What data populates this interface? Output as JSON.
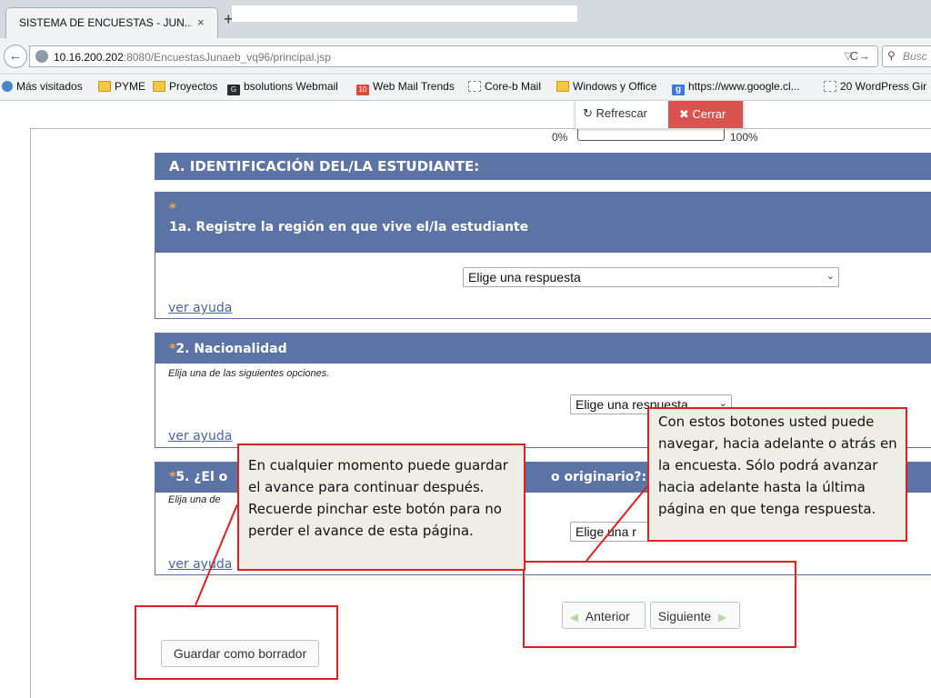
{
  "browser": {
    "tab_title": "SISTEMA DE ENCUESTAS - JUN...",
    "tab_close": "×",
    "new_tab": "+",
    "url_host": "10.16.200.202",
    "url_path": ":8080/EncuestasJunaeb_vq96/principal.jsp",
    "search_placeholder": "Busc",
    "bookmarks": [
      {
        "label": "Más visitados",
        "icon": "globe-icon"
      },
      {
        "label": "PYME",
        "icon": "folder-icon"
      },
      {
        "label": "Proyectos",
        "icon": "folder-icon"
      },
      {
        "label": "bsolutions Webmail",
        "icon": "bsolutions-icon"
      },
      {
        "label": "Web Mail Trends",
        "icon": "webmail-icon"
      },
      {
        "label": "Core-b Mail",
        "icon": "page-icon"
      },
      {
        "label": "Windows y Office",
        "icon": "folder-icon"
      },
      {
        "label": "https://www.google.cl...",
        "icon": "google-icon"
      },
      {
        "label": "20 WordPress Gir",
        "icon": "page-icon"
      }
    ]
  },
  "toolbar": {
    "refresh_label": "Refrescar",
    "close_label": "Cerrar"
  },
  "progress": {
    "min_label": "0%",
    "max_label": "100%",
    "value": 0
  },
  "section_a": {
    "title": "A. IDENTIFICACIÓN DEL/LA ESTUDIANTE:"
  },
  "questions": [
    {
      "required_mark": "*",
      "title": "1a. Registre la región en que vive el/la estudiante",
      "select_value": "Elige una respuesta",
      "help_label": "ver ayuda"
    },
    {
      "required_mark": "*",
      "title": "2. Nacionalidad",
      "subtitle": "Elija una de las siguientes opciones.",
      "select_value": "Elige una respuesta",
      "help_label": "ver ayuda"
    },
    {
      "required_mark": "*",
      "title_start": "5. ¿El o",
      "title_end": "o originario?:",
      "subtitle": "Elija una de",
      "select_value": "Elige una r",
      "help_label": "ver ayuda"
    }
  ],
  "navigation": {
    "prev_label": "Anterior",
    "next_label": "Siguiente",
    "save_label": "Guardar como borrador"
  },
  "annotations": {
    "left": "En cualquier momento puede guardar el avance para continuar después. Recuerde pinchar este botón para no perder el avance de esta página.",
    "right": "Con estos botones usted puede navegar, hacia adelante o atrás en la encuesta. Sólo podrá avanzar hacia adelante hasta la última página en que tenga respuesta."
  },
  "colors": {
    "header_blue": "#5b74a5",
    "required_orange": "#f0a64b",
    "annotation_red": "#e02020",
    "close_red": "#d9534f"
  }
}
